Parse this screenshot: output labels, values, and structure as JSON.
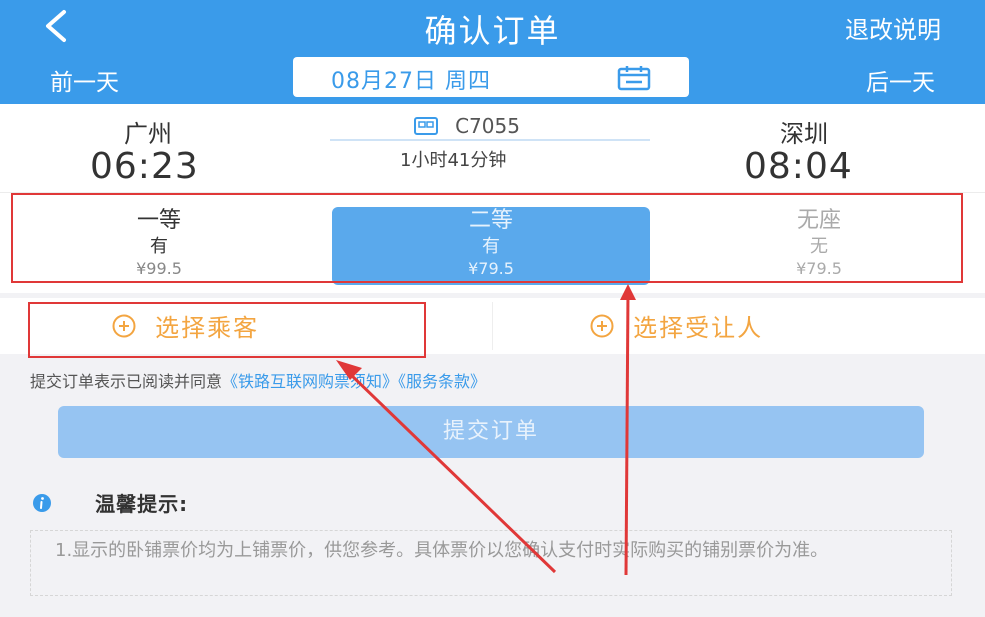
{
  "header": {
    "title": "确认订单",
    "refund_link": "退改说明",
    "prev_day": "前一天",
    "next_day": "后一天",
    "date": "08月27日 周四"
  },
  "train": {
    "from_city": "广州",
    "from_time": "06:23",
    "to_city": "深圳",
    "to_time": "08:04",
    "number": "C7055",
    "duration": "1小时41分钟"
  },
  "seats": [
    {
      "name": "一等",
      "availability": "有",
      "price": "¥99.5"
    },
    {
      "name": "二等",
      "availability": "有",
      "price": "¥79.5",
      "selected": true
    },
    {
      "name": "无座",
      "availability": "无",
      "price": "¥79.5"
    }
  ],
  "actions": {
    "choose_passenger": "选择乘客",
    "choose_recipient": "选择受让人",
    "submit": "提交订单"
  },
  "agreement": {
    "prefix": "提交订单表示已阅读并同意",
    "link1": "《铁路互联网购票须知》",
    "link2": "《服务条款》"
  },
  "tips": {
    "title": "温馨提示:",
    "text": "1.显示的卧铺票价均为上铺票价，供您参考。具体票价以您确认支付时实际购买的铺别票价为准。"
  },
  "colors": {
    "header_blue": "#3a9bea",
    "selected_seat": "#5aa9ec",
    "action_orange": "#f3a541",
    "submit_disabled": "#96c4f2",
    "annotation_red": "#e03838"
  },
  "icons": [
    "back-icon",
    "calendar-icon",
    "train-icon",
    "plus-icon",
    "info-icon"
  ]
}
